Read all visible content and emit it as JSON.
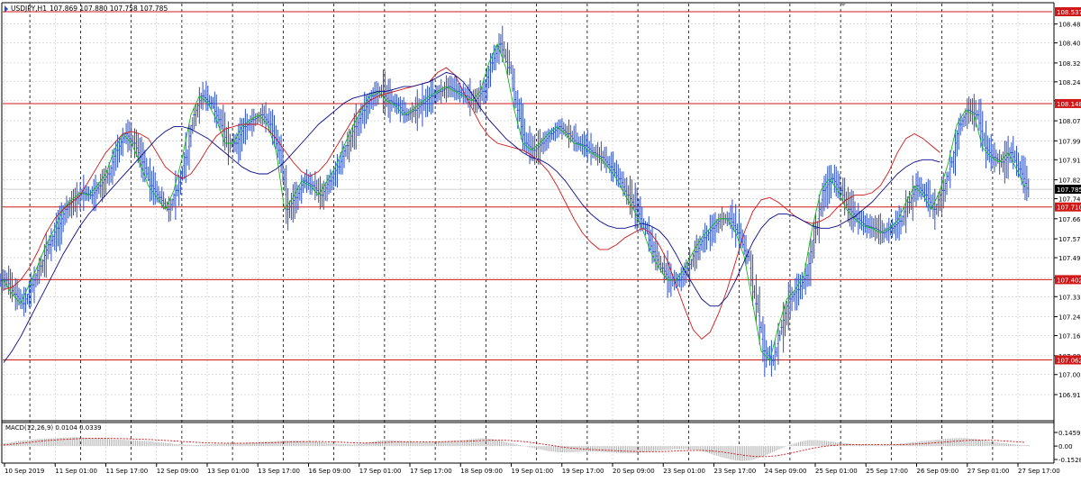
{
  "header": {
    "symbol_label": "USDJPY,H1",
    "ohlc_text": "107.869 107.880 107.758 107.785"
  },
  "macd_panel": {
    "label": "MACD(12,26,9) 0.0104 0.0339",
    "y_ticks": [
      "0.1459",
      "0.00",
      "-0.1528"
    ]
  },
  "colors": {
    "background": "#ffffff",
    "price_bars": "#2b50c8",
    "ma_fast": "#14b814",
    "ma_mid": "#d01818",
    "ma_slow": "#0a0a8c",
    "level_line": "#d01818",
    "level_tag_bg": "#d01818",
    "current_price_tag_bg": "#000000",
    "grid": "#c8c8c8",
    "macd_hist": "#b0b0b0",
    "macd_signal": "#d01818"
  },
  "chart_data": [
    {
      "type": "line",
      "title": "USDJPY,H1",
      "ylim": [
        106.915,
        108.56
      ],
      "y_ticks": [
        "108.485",
        "108.405",
        "108.320",
        "108.240",
        "108.160",
        "108.075",
        "107.990",
        "107.910",
        "107.825",
        "107.745",
        "107.660",
        "107.575",
        "107.495",
        "107.410",
        "107.330",
        "107.245",
        "107.165",
        "107.080",
        "107.000",
        "106.915"
      ],
      "x_ticks": [
        "10 Sep 2019",
        "11 Sep 01:00",
        "11 Sep 17:00",
        "12 Sep 09:00",
        "13 Sep 01:00",
        "13 Sep 17:00",
        "16 Sep 09:00",
        "17 Sep 01:00",
        "17 Sep 17:00",
        "18 Sep 09:00",
        "19 Sep 01:00",
        "19 Sep 17:00",
        "20 Sep 09:00",
        "23 Sep 01:00",
        "23 Sep 17:00",
        "24 Sep 09:00",
        "25 Sep 01:00",
        "25 Sep 17:00",
        "26 Sep 09:00",
        "27 Sep 01:00",
        "27 Sep 17:00"
      ],
      "horizontal_levels": [
        "108.537",
        "108.148",
        "107.710",
        "107.402",
        "107.062"
      ],
      "current_price": "107.785",
      "grid": true,
      "series": [
        {
          "values": [
            107.4,
            107.34,
            107.3,
            107.38,
            107.46,
            107.55,
            107.62,
            107.7,
            107.74,
            107.77,
            107.76,
            107.8,
            107.85,
            107.95,
            108.02,
            107.98,
            107.9,
            107.8,
            107.75,
            107.7,
            107.78,
            107.92,
            108.1,
            108.18,
            108.15,
            108.08,
            107.98,
            107.98,
            108.05,
            108.08,
            108.1,
            108.06,
            107.95,
            107.7,
            107.75,
            107.82,
            107.8,
            107.76,
            107.82,
            107.88,
            107.97,
            108.05,
            108.12,
            108.18,
            108.2,
            108.16,
            108.14,
            108.1,
            108.12,
            108.15,
            108.18,
            108.2,
            108.22,
            108.2,
            108.18,
            108.16,
            108.2,
            108.32,
            108.4,
            108.3,
            108.12,
            107.98,
            107.95,
            107.98,
            108.02,
            108.05,
            108.02,
            107.98,
            107.97,
            107.94,
            107.92,
            107.88,
            107.83,
            107.76,
            107.7,
            107.62,
            107.52,
            107.45,
            107.4,
            107.4,
            107.45,
            107.52,
            107.58,
            107.62,
            107.66,
            107.66,
            107.6,
            107.5,
            107.3,
            107.1,
            107.06,
            107.2,
            107.32,
            107.36,
            107.42,
            107.62,
            107.78,
            107.83,
            107.78,
            107.7,
            107.66,
            107.63,
            107.62,
            107.6,
            107.62,
            107.65,
            107.73,
            107.8,
            107.76,
            107.7,
            107.78,
            107.9,
            108.06,
            108.12,
            108.1,
            107.96,
            107.92,
            107.9,
            107.94,
            107.87,
            107.79
          ]
        },
        {
          "values": [
            107.36,
            107.37,
            107.4,
            107.45,
            107.52,
            107.6,
            107.66,
            107.7,
            107.73,
            107.76,
            107.82,
            107.88,
            107.94,
            107.98,
            108.02,
            108.03,
            108.02,
            108.0,
            107.94,
            107.88,
            107.85,
            107.83,
            107.85,
            107.9,
            107.96,
            108.01,
            108.04,
            108.05,
            108.06,
            108.06,
            108.06,
            108.04,
            108.0,
            107.95,
            107.9,
            107.86,
            107.84,
            107.86,
            107.9,
            107.96,
            108.02,
            108.08,
            108.13,
            108.16,
            108.18,
            108.19,
            108.2,
            108.21,
            108.22,
            108.23,
            108.24,
            108.28,
            108.3,
            108.27,
            108.2,
            108.13,
            108.06,
            108.01,
            107.98,
            107.97,
            107.96,
            107.95,
            107.93,
            107.9,
            107.86,
            107.8,
            107.73,
            107.66,
            107.6,
            107.56,
            107.53,
            107.53,
            107.55,
            107.58,
            107.6,
            107.62,
            107.6,
            107.55,
            107.48,
            107.38,
            107.28,
            107.19,
            107.15,
            107.18,
            107.26,
            107.36,
            107.48,
            107.6,
            107.69,
            107.74,
            107.75,
            107.73,
            107.7,
            107.67,
            107.65,
            107.64,
            107.65,
            107.67,
            107.71,
            107.74,
            107.76,
            107.76,
            107.77,
            107.8,
            107.86,
            107.94,
            108.0,
            108.02,
            108.0,
            107.97,
            107.94
          ]
        },
        {
          "values": [
            107.05,
            107.1,
            107.16,
            107.23,
            107.3,
            107.37,
            107.44,
            107.51,
            107.57,
            107.63,
            107.68,
            107.72,
            107.76,
            107.8,
            107.84,
            107.88,
            107.92,
            107.96,
            108.0,
            108.03,
            108.05,
            108.05,
            108.04,
            108.02,
            108.0,
            107.97,
            107.94,
            107.91,
            107.88,
            107.86,
            107.85,
            107.85,
            107.87,
            107.9,
            107.94,
            107.98,
            108.02,
            108.06,
            108.09,
            108.12,
            108.15,
            108.17,
            108.18,
            108.19,
            108.2,
            108.2,
            108.21,
            108.22,
            108.22,
            108.23,
            108.24,
            108.26,
            108.28,
            108.27,
            108.24,
            108.19,
            108.13,
            108.08,
            108.04,
            108.0,
            107.97,
            107.94,
            107.92,
            107.91,
            107.89,
            107.86,
            107.82,
            107.77,
            107.72,
            107.68,
            107.65,
            107.63,
            107.62,
            107.62,
            107.63,
            107.64,
            107.63,
            107.61,
            107.57,
            107.51,
            107.44,
            107.38,
            107.32,
            107.29,
            107.29,
            107.33,
            107.4,
            107.48,
            107.56,
            107.62,
            107.66,
            107.68,
            107.68,
            107.67,
            107.65,
            107.63,
            107.62,
            107.62,
            107.63,
            107.65,
            107.67,
            107.7,
            107.73,
            107.77,
            107.81,
            107.85,
            107.88,
            107.9,
            107.91,
            107.91,
            107.9
          ]
        }
      ]
    },
    {
      "type": "bar",
      "title": "MACD(12,26,9) 0.0104 0.0339",
      "ylim": [
        -0.1528,
        0.1459
      ],
      "series": [
        {
          "values": [
            0.02,
            0.035,
            0.05,
            0.06,
            0.07,
            0.075,
            0.08,
            0.085,
            0.09,
            0.085,
            0.08,
            0.075,
            0.07,
            0.065,
            0.06,
            0.055,
            0.05,
            0.04,
            0.03,
            0.02,
            0.015,
            0.01,
            0.015,
            0.02,
            0.025,
            0.03,
            0.03,
            0.035,
            0.04,
            0.045,
            0.05,
            0.055,
            0.055,
            0.05,
            0.045,
            0.035,
            0.025,
            0.02,
            0.015,
            0.025,
            0.04,
            0.055,
            0.06,
            0.055,
            0.045,
            0.04,
            0.04,
            0.045,
            0.05,
            0.055,
            0.06,
            0.07,
            0.08,
            0.07,
            0.05,
            0.03,
            0.01,
            -0.01,
            -0.03,
            -0.05,
            -0.06,
            -0.065,
            -0.06,
            -0.055,
            -0.055,
            -0.06,
            -0.065,
            -0.07,
            -0.07,
            -0.065,
            -0.055,
            -0.045,
            -0.035,
            -0.03,
            -0.03,
            -0.04,
            -0.06,
            -0.09,
            -0.12,
            -0.14,
            -0.15,
            -0.14,
            -0.11,
            -0.07,
            -0.03,
            0.01,
            0.04,
            0.06,
            0.06,
            0.05,
            0.04,
            0.03,
            0.02,
            0.015,
            0.01,
            0.01,
            0.015,
            0.025,
            0.035,
            0.045,
            0.055,
            0.065,
            0.075,
            0.08,
            0.08,
            0.07,
            0.055,
            0.04,
            0.03,
            0.02,
            0.01
          ]
        },
        {
          "values": [
            0.01,
            0.02,
            0.03,
            0.04,
            0.05,
            0.058,
            0.064,
            0.069,
            0.074,
            0.077,
            0.078,
            0.078,
            0.076,
            0.074,
            0.071,
            0.068,
            0.064,
            0.059,
            0.054,
            0.048,
            0.042,
            0.036,
            0.032,
            0.03,
            0.029,
            0.029,
            0.029,
            0.03,
            0.032,
            0.035,
            0.038,
            0.041,
            0.044,
            0.045,
            0.045,
            0.043,
            0.04,
            0.036,
            0.032,
            0.031,
            0.033,
            0.037,
            0.041,
            0.044,
            0.044,
            0.043,
            0.043,
            0.043,
            0.045,
            0.047,
            0.049,
            0.053,
            0.058,
            0.06,
            0.058,
            0.053,
            0.045,
            0.034,
            0.021,
            0.007,
            -0.007,
            -0.019,
            -0.027,
            -0.033,
            -0.038,
            -0.042,
            -0.047,
            -0.051,
            -0.055,
            -0.057,
            -0.057,
            -0.055,
            -0.051,
            -0.047,
            -0.044,
            -0.043,
            -0.047,
            -0.055,
            -0.068,
            -0.083,
            -0.096,
            -0.105,
            -0.106,
            -0.099,
            -0.085,
            -0.066,
            -0.045,
            -0.024,
            -0.007,
            0.004,
            0.011,
            0.015,
            0.016,
            0.016,
            0.015,
            0.014,
            0.014,
            0.016,
            0.02,
            0.025,
            0.031,
            0.038,
            0.045,
            0.052,
            0.058,
            0.06,
            0.059,
            0.055,
            0.05,
            0.044,
            0.037
          ]
        }
      ]
    }
  ]
}
